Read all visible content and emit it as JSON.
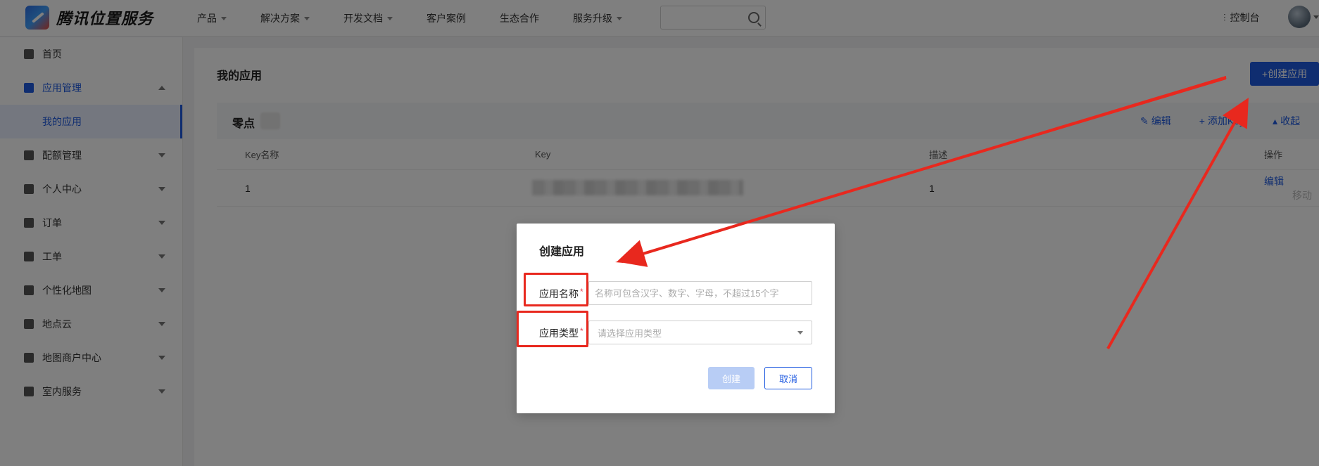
{
  "header": {
    "brand": "腾讯位置服务",
    "nav": [
      {
        "label": "产品",
        "has_caret": true
      },
      {
        "label": "解决方案",
        "has_caret": true
      },
      {
        "label": "开发文档",
        "has_caret": true
      },
      {
        "label": "客户案例",
        "has_caret": false
      },
      {
        "label": "生态合作",
        "has_caret": false
      },
      {
        "label": "服务升级",
        "has_caret": true
      }
    ],
    "search_placeholder": "",
    "console_label": "控制台"
  },
  "sidebar": {
    "items": [
      {
        "label": "首页"
      },
      {
        "label": "应用管理"
      },
      {
        "label": "我的应用"
      },
      {
        "label": "配额管理"
      },
      {
        "label": "个人中心"
      },
      {
        "label": "订单"
      },
      {
        "label": "工单"
      },
      {
        "label": "个性化地图"
      },
      {
        "label": "地点云"
      },
      {
        "label": "地图商户中心"
      },
      {
        "label": "室内服务"
      }
    ]
  },
  "main": {
    "title": "我的应用",
    "create_button": "+创建应用",
    "app": {
      "name": "零点",
      "actions": {
        "edit": "编辑",
        "add_key": "添加Key",
        "collapse": "收起"
      }
    },
    "table": {
      "headers": [
        "Key名称",
        "Key",
        "描述",
        "操作"
      ],
      "rows": [
        {
          "name": "1",
          "key": "",
          "desc": "1",
          "edit": "编辑",
          "move": "移动"
        }
      ]
    }
  },
  "modal": {
    "title": "创建应用",
    "name_label": "应用名称",
    "name_placeholder": "名称可包含汉字、数字、字母，不超过15个字",
    "type_label": "应用类型",
    "type_placeholder": "请选择应用类型",
    "required_mark": "*",
    "create_button": "创建",
    "cancel_button": "取消"
  },
  "colors": {
    "primary": "#1f5ae0",
    "annotation": "#e8281e"
  }
}
